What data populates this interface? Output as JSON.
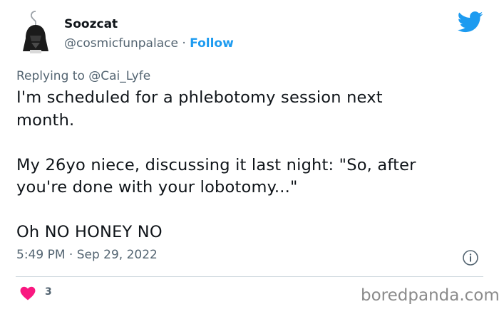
{
  "colors": {
    "link_blue": "#1d9bf0",
    "muted_gray": "#536471",
    "text_dark": "#0f1419",
    "like_pink": "#f91880",
    "watermark_gray": "#8a8a8a"
  },
  "author": {
    "avatar_icon": "helmet-earring-avatar-icon",
    "display_name": "Soozcat",
    "handle": "@cosmicfunpalace",
    "separator": " · ",
    "follow_label": "Follow"
  },
  "brand_icon": "twitter-bird-icon",
  "reply_context": {
    "prefix": "Replying to ",
    "mention": "@Cai_Lyfe"
  },
  "tweet": {
    "line1": "I'm scheduled for a phlebotomy session next",
    "line2": "month.",
    "line3": "My 26yo niece, discussing it last night: \"So, after",
    "line4": "you're done with your lobotomy...\"",
    "line5": "Oh NO HONEY NO"
  },
  "meta": {
    "time": "5:49 PM",
    "separator": " · ",
    "date": "Sep 29, 2022",
    "info_icon": "info-icon"
  },
  "engagement": {
    "like_icon": "heart-icon",
    "like_count": "3"
  },
  "watermark": "boredpanda.com"
}
